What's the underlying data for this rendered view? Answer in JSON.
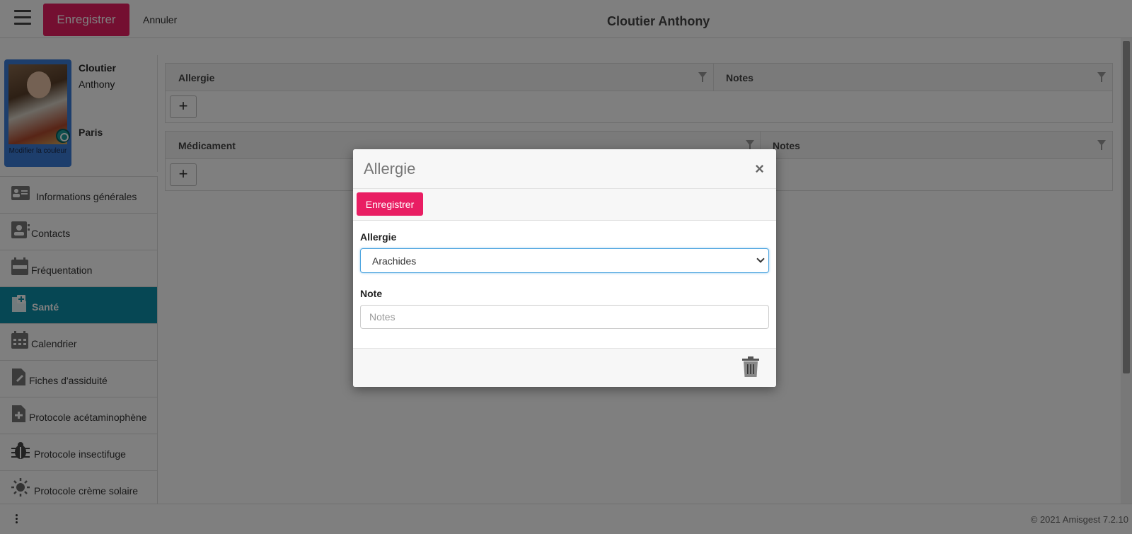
{
  "header": {
    "save_label": "Enregistrer",
    "cancel_label": "Annuler",
    "title": "Cloutier Anthony",
    "menu_icon": "hamburger-icon"
  },
  "profile": {
    "last_name": "Cloutier",
    "first_name": "Anthony",
    "group": "Paris",
    "modify_color_label": "Modifier la couleur",
    "badge_color": "#1d9d9b"
  },
  "sidebar": {
    "active_color": "#0d8fa8",
    "items": [
      {
        "label": "Informations générales",
        "icon": "id-card-icon"
      },
      {
        "label": "Contacts",
        "icon": "contact-book-icon"
      },
      {
        "label": "Fréquentation",
        "icon": "calendar-icon"
      },
      {
        "label": "Santé",
        "icon": "medical-file-icon",
        "active": true
      },
      {
        "label": "Calendrier",
        "icon": "calendar-grid-icon"
      },
      {
        "label": "Fiches d'assiduité",
        "icon": "file-edit-icon"
      },
      {
        "label": "Protocole acétaminophène",
        "icon": "file-plus-icon"
      },
      {
        "label": "Protocole insectifuge",
        "icon": "bug-icon"
      },
      {
        "label": "Protocole crème solaire",
        "icon": "sun-icon"
      }
    ]
  },
  "allergy_grid": {
    "columns": [
      "Allergie",
      "Notes"
    ],
    "add_label": "+"
  },
  "medication_grid": {
    "columns": [
      "Médicament",
      "Notes"
    ],
    "add_label": "+"
  },
  "footer": {
    "copyright": "© 2021 Amisgest 7.2.10"
  },
  "modal": {
    "title": "Allergie",
    "close_label": "×",
    "save_label": "Enregistrer",
    "allergy_label": "Allergie",
    "allergy_value": "Arachides",
    "note_label": "Note",
    "note_placeholder": "Notes",
    "accent_color": "#e91e63"
  }
}
